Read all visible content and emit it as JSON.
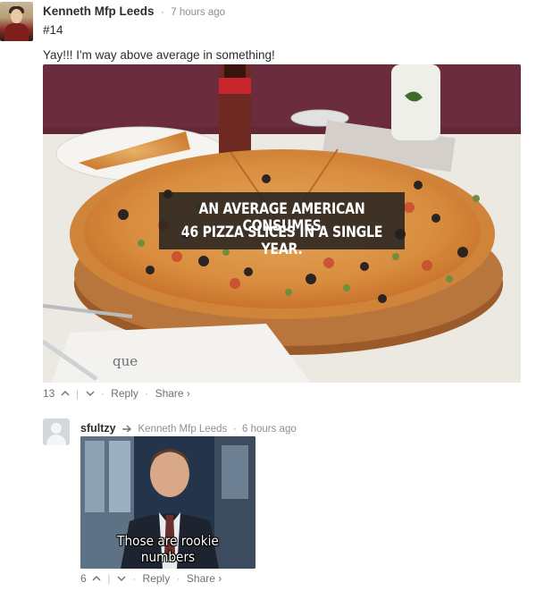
{
  "comment1": {
    "author": "Kenneth Mfp Leeds",
    "time": "7 hours ago",
    "number": "#14",
    "text": "Yay!!! I'm way above average in something!",
    "image": {
      "caption_line1": "AN AVERAGE AMERICAN CONSUMES",
      "caption_line2": "46 PIZZA SLICES IN A SINGLE YEAR.",
      "menu_text": "que"
    },
    "footer": {
      "votes": "13",
      "reply": "Reply",
      "share": "Share ›"
    }
  },
  "comment2": {
    "author": "sfultzy",
    "reply_to": "Kenneth Mfp Leeds",
    "time": "6 hours ago",
    "image": {
      "caption": "Those are rookie numbers"
    },
    "footer": {
      "votes": "6",
      "reply": "Reply",
      "share": "Share ›"
    }
  },
  "icons": {
    "upvote": "chevron-up-icon",
    "downvote": "chevron-down-icon",
    "reply_arrow": "reply-arrow-icon"
  },
  "colors": {
    "text": "#2a2e2e",
    "meta": "#8a9094",
    "link": "#6b7277"
  }
}
